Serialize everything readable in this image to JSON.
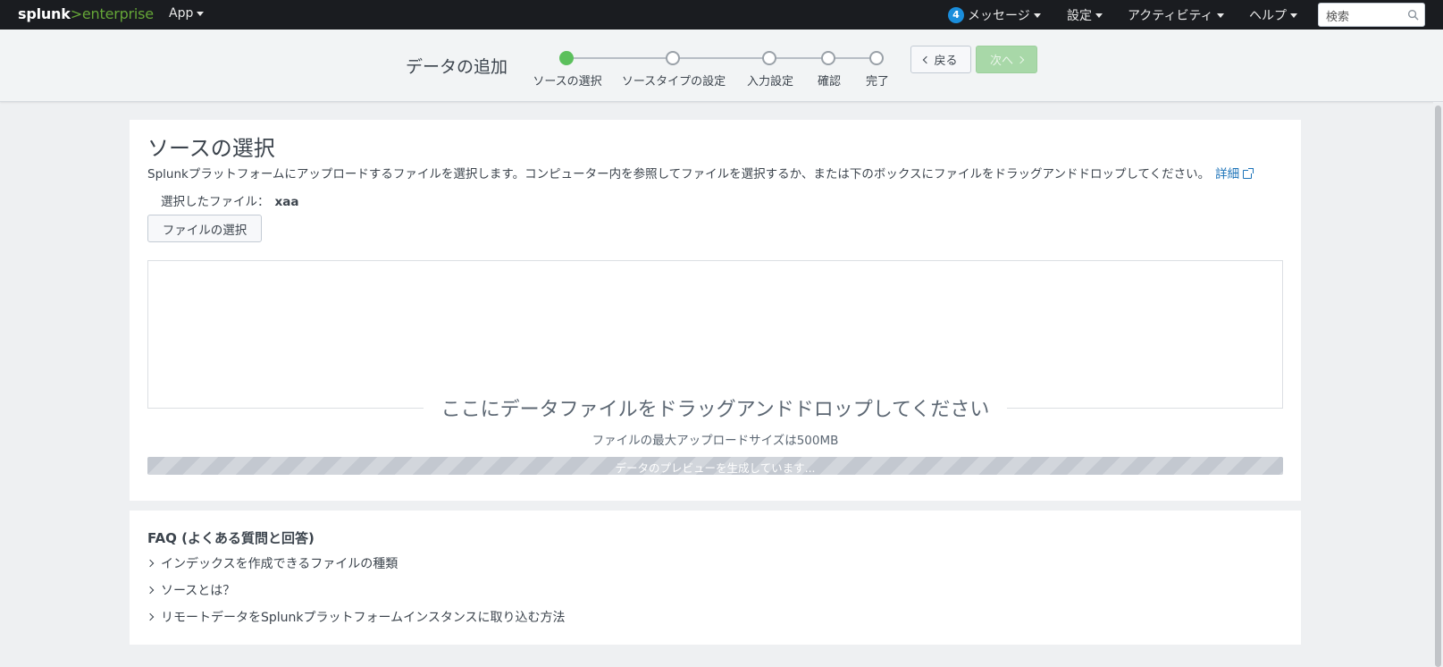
{
  "nav": {
    "logo_splunk": "splunk",
    "logo_gt": ">",
    "logo_enterprise": "enterprise",
    "app": "App",
    "messages_count": "4",
    "messages": "メッセージ",
    "settings": "設定",
    "activity": "アクティビティ",
    "help": "ヘルプ",
    "search_placeholder": "検索"
  },
  "wizard": {
    "title": "データの追加",
    "steps": [
      "ソースの選択",
      "ソースタイプの設定",
      "入力設定",
      "確認",
      "完了"
    ],
    "current_step": 1,
    "back": "戻る",
    "next": "次へ"
  },
  "main": {
    "title": "ソースの選択",
    "description": "Splunkプラットフォームにアップロードするファイルを選択します。コンピューター内を参照してファイルを選択するか、または下のボックスにファイルをドラッグアンドドロップしてください。",
    "learn_more": "詳細",
    "selected_file_label": "選択したファイル：",
    "selected_file_name": "xaa",
    "select_file_button": "ファイルの選択",
    "drop_text": "ここにデータファイルをドラッグアンドドロップしてください",
    "max_size": "ファイルの最大アップロードサイズは500MB",
    "progress_text": "データのプレビューを生成しています..."
  },
  "faq": {
    "title": "FAQ (よくある質問と回答)",
    "items": [
      "インデックスを作成できるファイルの種類",
      "ソースとは？",
      "リモートデータをSplunkプラットフォームインスタンスに取り込む方法"
    ]
  }
}
